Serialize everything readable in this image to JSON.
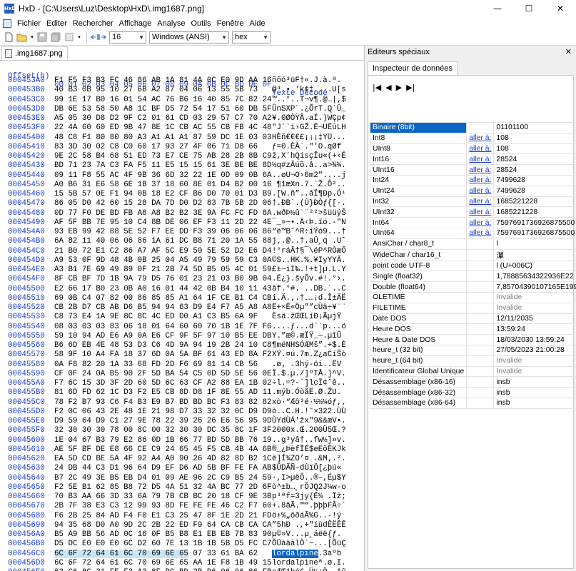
{
  "window": {
    "title": "HxD - [C:\\Users\\Luz\\Desktop\\HxD\\.img1687.png]",
    "minimize": "—",
    "maximize": "☐",
    "close": "✕"
  },
  "menu": [
    "Fichier",
    "Editer",
    "Rechercher",
    "Affichage",
    "Analyse",
    "Outils",
    "Fenêtre",
    "Aide"
  ],
  "toolbar": {
    "bytes_per_row": "16",
    "charset": "Windows (ANSI)",
    "display_mode": "hex"
  },
  "file_tab": ".img1687.png",
  "hex_view": {
    "offset_header": "Offset(h)",
    "column_header": "00 01 02 03 04 05 06 07 08 09 0A 0B 0C 0D 0E 0F",
    "text_header": "Texte Décodé",
    "rows": [
      {
        "off": "000453A0",
        "bytes": "F1 F5 F3 B3 FC 46 86 AB 1A 81 4A 0C E0 9D AA 16",
        "text": "ñõó³üF†«.J.à.ª."
      },
      {
        "off": "000453B0",
        "bytes": "40 B3 0B 95 10 27 6B A2 87 04 06 13 55 5B 73 ",
        "text": "@³.•.'k¢‡....U[s"
      },
      {
        "off": "000453C0",
        "bytes": "99 1E 17 B0 16 01 54 AC 76 B6 16 40 85 7C 82 24",
        "text": "™..°..T¬v¶.@…|‚$"
      },
      {
        "off": "000453D0",
        "bytes": "DB 6E 53 58 50 A8 1C BF D5 72 54 17 51 60 DB 5F",
        "text": "ÛnSXP¨.¿ÕrT.Q`Û_"
      },
      {
        "off": "000453E0",
        "bytes": "A5 05 30 D8 D2 9F C2 01 61 CD 03 29 57 C7 70 A2",
        "text": "¥.0ØÒŸÂ.aÍ.)WÇp¢"
      },
      {
        "off": "000453F0",
        "bytes": "22 4A 60 60 ED 9B 47 8E 1C CB AC 55 CB FB 4C 48",
        "text": "\"J``í›GŽ.Ë¬UËûLH"
      },
      {
        "off": "00045400",
        "bytes": "48 C8 F1 80 80 80 A3 A1 A1 A1 87 59 DC 1E 03 03",
        "text": "HÈñ€€€£¡¡¡‡YÜ..."
      },
      {
        "off": "00045410",
        "bytes": "83 3D 30 02 C8 C0 60 17 93 27 4F 06 71 D8 66 ",
        "text": "ƒ=0.ÈÀ`.\"'O.qØf"
      },
      {
        "off": "00045420",
        "bytes": "9E 2C 58 B4 68 51 ED 73 E7 CE 75 AB 28 2B 8B C9",
        "text": "ž,X´hQísçÎu«(+‹É"
      },
      {
        "off": "00045430",
        "bytes": "BD 71 23 7A C3 FA F5 11 E5 15 15 61 3E BE BE 8D",
        "text": "½q#zÃúõ.å..a>¾¾."
      },
      {
        "off": "00045440",
        "bytes": "09 11 F8 55 AC 4F 9B 36 6D 32 22 1E 0D 09 0B 6A",
        "text": "..øU¬O›6m2\"....j"
      },
      {
        "off": "00045450",
        "bytes": "A0 B6 31 E6 58 6E 1B 37 18 60 8E 01 D4 B2 00 16",
        "text": " ¶1æXn.7.`Ž.Ô².."
      },
      {
        "off": "00045460",
        "bytes": "15 5B 57 0E F1 94 0B 18 E2 CF B6 D0 70 01 D3 B9",
        "text": ".[W.ñ”..âÏ¶Ðp.Ó¹"
      },
      {
        "off": "00045470",
        "bytes": "86 05 D0 42 60 15 28 DA 7D D0 D2 83 7B 5B 2D 06",
        "text": "†.ÐB`.(Ú}ÐÒƒ{[-."
      },
      {
        "off": "00045480",
        "bytes": "0D 77 F0 DE BD FB A8 A8 B2 B2 3E 9A FC FC FD 8A",
        "text": ".wðÞ½û¨¨²²>šüüýŠ"
      },
      {
        "off": "00045490",
        "bytes": "AF 5F BB 7E 95 10 C4 8B DE 06 EF F3 11 2D 22 4E",
        "text": "¯_»~•.Ä‹Þ.ïó.-\"N"
      },
      {
        "off": "000454A0",
        "bytes": "93 EB 99 42 88 5E 52 F7 EE DD F3 39 06 06 06 86",
        "text": "“ë™Bˆ^R÷îÝó9...†"
      },
      {
        "off": "000454B0",
        "bytes": "6A 82 11 40 06 06 86 1A 61 DC B8 71 20 1A 55 88",
        "text": "j‚.@..†.aÜ¸q .Uˆ"
      },
      {
        "off": "000454C0",
        "bytes": "21 B0 72 E1 C2 86 A7 AF 5C E9 50 5E 52 D2 E6 D4",
        "text": "!°ráÂ†§¯\\éP^RÒæÔ"
      },
      {
        "off": "000454D0",
        "bytes": "A9 53 0F 9D 48 4B 0B 25 04 A5 49 79 59 59 C3 0A",
        "text": "©S..HK.%.¥IyYYÃ."
      },
      {
        "off": "000454E0",
        "bytes": "A3 B1 7E 69 49 89 0F 21 2B 74 5D B5 05 4C 01 59",
        "text": "£±~iI‰.!+t]µ.L.Y"
      },
      {
        "off": "000454F0",
        "bytes": "8F CB BF 7D 1B 9A 79 D5 76 01 23 21 03 B0 9B 04",
        "text": ".Ë¿}.šyÕv.#!.°›."
      },
      {
        "off": "00045500",
        "bytes": "E2 66 17 B0 23 0B A0 16 01 44 42 0B B4 10 11 43",
        "text": "âf.°#. ..DB.´..C"
      },
      {
        "off": "00045510",
        "bytes": "69 0B C4 07 82 00 86 85 85 A1 64 1F CE B1 C4 CB",
        "text": "i.Ä.‚.†……¡d.Î±ÄË"
      },
      {
        "off": "00045520",
        "bytes": "CB 2B D7 CB AB D6 B5 94 94 63 D9 E4 F7 A5 A8 A8",
        "text": "Ë+×Ë«Öµ””cÙä÷¥¨¨"
      },
      {
        "off": "00045530",
        "bytes": "C8 73 E4 1A 9E 8C 8C 4C ED D0 A1 C3 B5 6A 9F ",
        "text": "Èsä.žŒŒLíÐ¡ÃµjŸ"
      },
      {
        "off": "00045540",
        "bytes": "08 03 03 03 83 06 18 01 64 60 60 70 1B 1E 7F F6",
        "text": "....ƒ...d``p...ö"
      },
      {
        "off": "00045550",
        "bytes": "59 10 94 AD E6 A9 0A E6 CF 9F 5F 97 10 B5 EE DB",
        "text": "Y.”­æ©.æÏŸ_—.µîÛ"
      },
      {
        "off": "00045560",
        "bytes": "B6 6D EB 4E 48 53 D3 C6 4D 9A 94 19 2B 24 10 C8",
        "text": "¶mëNHSÓÆMš”.+$.È"
      },
      {
        "off": "00045570",
        "bytes": "58 9F 10 A4 FA 18 37 6D 0A 5A BF 61 43 ED 8A F2",
        "text": "XŸ.¤ú.7m.Z¿aCíŠò"
      },
      {
        "off": "00045580",
        "bytes": "0A F8 82 20 1A 33 68 FD 2D F6 69 81 14 CB 56 ",
        "text": ".ø‚ .3hý-öi..ËV"
      },
      {
        "off": "00045590",
        "bytes": "CF 0F 24 0A B5 90 2F 5D BA 54 C5 0D 5D 5E 56 0E",
        "text": "Ï.$.µ./]ºTÅ.]^V."
      },
      {
        "off": "000455A0",
        "bytes": "F7 6C 15 3D 3F 2D 60 5D 6C 63 CF A2 88 EA 1B 02",
        "text": "÷l.=?-`]lcÏ¢ˆê.."
      },
      {
        "off": "000455B0",
        "bytes": "81 6D FD 62 1C D3 F2 E5 CB 8D D8 1F 8E 55 AD 11",
        "text": ".mýb.ÓòåË.Ø.ŽU­."
      },
      {
        "off": "000455C0",
        "bytes": "78 F2 B7 93 C6 F4 B3 E9 B7 BD BD BC F3 83 82 82",
        "text": "xò·“Æô³é·½½¼óƒ‚‚"
      },
      {
        "off": "000455D0",
        "bytes": "F2 0C 06 43 2E 48 1E 21 98 D7 33 32 32 0C D9 D9",
        "text": "ò..C.H.!˜×322.ÙÙ"
      },
      {
        "off": "000455E0",
        "bytes": "D9 59 64 D9 C1 27 9E 78 22 39 26 26 E6 56 95 9D",
        "text": "ÙYdÙÁ'žx\"9&&æV•."
      },
      {
        "off": "000455F0",
        "bytes": "32 30 30 30 78 00 8C 00 32 30 30 DC 35 8C 1F 3F",
        "text": "2000x.Œ.200Ü5Œ.?"
      },
      {
        "off": "00045600",
        "bytes": "1E 04 67 B3 79 E2 86 0D 1B 66 77 BD 5D BB 76 19",
        "text": "..g³yâ†..fw½]»v."
      },
      {
        "off": "00045610",
        "bytes": "AE 5F BF DE E8 66 CE C9 24 65 45 F5 CB 4B 4A 6B",
        "text": "®_¿ÞèfÎÉ$eEõËKJk"
      },
      {
        "off": "00045620",
        "bytes": "EA 5D CD BE 5A 4F 92 A4 A0 90 26 4D 82 8D B2 1C",
        "text": "ê]Í¾ZO’¤ .&M‚.²."
      },
      {
        "off": "00045630",
        "bytes": "24 DB 44 C3 D1 96 64 D9 EF D6 AD 5B BF FE FA AB",
        "text": "$ÛDÃÑ–dÙïÖ­[¿þú«"
      },
      {
        "off": "00045640",
        "bytes": "B7 2C 49 3E B5 EB D4 01 09 AE 96 2C C9 B5 24 59",
        "text": "·,I>µëÔ..®–,Éµ$Y"
      },
      {
        "off": "00045650",
        "bytes": "F2 5E B1 62 85 B8 72 D5 4A 51 32 4A BC 77 2D 6F",
        "text": "ò^±b…¸rÕJQ2J¼w-o"
      },
      {
        "off": "00045660",
        "bytes": "70 B3 AA 66 3D 33 6A 79 7B CB BC 20 18 CF 9E 3B",
        "text": "p³ªf=3jy{Ë¼ .Ïž;"
      },
      {
        "off": "00045670",
        "bytes": "2B 7F 38 E3 C3 12 99 93 8D FE FE FE 46 C2 F7 60",
        "text": "+.8ãÃ.™“.þþþFÂ÷`"
      },
      {
        "off": "00045680",
        "bytes": "F6 2B 25 84 AD F4 F0 E1 C3 25 47 8F 1E 2D 21 FD",
        "text": "ö+%„­ôðáÃ%G..-!ý"
      },
      {
        "off": "00045690",
        "bytes": "94 35 68 D0 A0 9D 2C 2B 22 ED F9 64 CA CB CA CA",
        "text": "”5hÐ .,+\"íùdÊËÊÊ"
      },
      {
        "off": "000456A0",
        "bytes": "B5 A9 BB 56 AD 0C 16 0F B5 B8 E1 EB EB 7B 83 90",
        "text": "µ©»V­...µ¸áëë{ƒ."
      },
      {
        "off": "000456B0",
        "bytes": "D5 DC E0 E0 E0 6C D2 60 7E 13 1B 1B 5B D5 FC C7",
        "text": "ÕÜàààlÒ`~...[ÕüÇ"
      },
      {
        "off": "000456C0",
        "bytes": "C0 C0 70 0F C1 28 02 03 C3 7D 07 33 61 BA 62 ",
        "text": "ÀÀp.Á(..Ã}.3aºb"
      },
      {
        "off": "000456D0",
        "bytes": "6C 6F 72 64 61 6C 70 69 6E 65 AA 1E F8 1B 49 15",
        "text": "lordalpineª.ø.I."
      },
      {
        "off": "000456E0",
        "bytes": "63 C6 8C 31 FE F3 A3 8F DC BD 2B D6 06 06 86 FB",
        "text": "cÆŒ1þó£.Ü½+Ö..†û"
      },
      {
        "off": "000456F0",
        "bytes": "16 FF 1F BD 9D C2 CF 58 FF 04 A4 00 00 00 00 49",
        "text": ".ÿ.½.ÂÏXÿ.¤....I"
      },
      {
        "off": "00045700",
        "bytes": "45 4E 44 AE 42 60 82",
        "text": "END®B`‚"
      }
    ],
    "selected_row_index": 50,
    "selected_bytes": "6C 6F 72 64 61 6C 70 69 6E 65",
    "selected_text": "lordalpine"
  },
  "right_panel": {
    "title": "Editeurs spéciaux",
    "close": "✕",
    "tab": "Inspecteur de données",
    "nav": [
      "|◀",
      "◀",
      "▶",
      "▶|"
    ],
    "link_label": "aller à:",
    "rows": [
      {
        "name": "Binaire (8bit)",
        "link": "",
        "value": "01101100",
        "selected": true
      },
      {
        "name": "Int8",
        "link": "aller à:",
        "value": "108"
      },
      {
        "name": "UInt8",
        "link": "aller à:",
        "value": "108"
      },
      {
        "name": "Int16",
        "link": "aller à:",
        "value": "28524"
      },
      {
        "name": "UInt16",
        "link": "aller à:",
        "value": "28524"
      },
      {
        "name": "Int24",
        "link": "aller à:",
        "value": "7499628"
      },
      {
        "name": "UInt24",
        "link": "aller à:",
        "value": "7499628"
      },
      {
        "name": "Int32",
        "link": "aller à:",
        "value": "1685221228"
      },
      {
        "name": "UInt32",
        "link": "aller à:",
        "value": "1685221228"
      },
      {
        "name": "Int64",
        "link": "aller à:",
        "value": "7597691736926875500"
      },
      {
        "name": "UInt64",
        "link": "aller à:",
        "value": "7597691736926875500"
      },
      {
        "name": "AnsiChar / char8_t",
        "link": "",
        "value": "l"
      },
      {
        "name": "WideChar / char16_t",
        "link": "",
        "value": "潬"
      },
      {
        "name": "point code UTF-8",
        "link": "",
        "value": "l (U+006C)"
      },
      {
        "name": "Single (float32)",
        "link": "",
        "value": "1,78885634322936E22"
      },
      {
        "name": "Double (float64)",
        "link": "",
        "value": "7,85704390107165E199"
      },
      {
        "name": "OLETIME",
        "link": "",
        "value": "Invalide",
        "invalid": true
      },
      {
        "name": "FILETIME",
        "link": "",
        "value": "Invalide",
        "invalid": true
      },
      {
        "name": "Date DOS",
        "link": "",
        "value": "12/11/2035"
      },
      {
        "name": "Heure DOS",
        "link": "",
        "value": "13:59:24"
      },
      {
        "name": "Heure & Date DOS",
        "link": "",
        "value": "18/03/2030 13:59:24"
      },
      {
        "name": "heure_t (32 bit)",
        "link": "",
        "value": "27/05/2023 21:00:28"
      },
      {
        "name": "heure_t (64 bit)",
        "link": "",
        "value": "Invalide",
        "invalid": true
      },
      {
        "name": "Identificateur Global Unique",
        "link": "",
        "value": "Invalide",
        "invalid": true
      },
      {
        "name": "Désassemblage (x86-16)",
        "link": "",
        "value": "insb"
      },
      {
        "name": "Désassemblage (x86-32)",
        "link": "",
        "value": "insb"
      },
      {
        "name": "Désassemblage (x86-64)",
        "link": "",
        "value": "insb"
      }
    ]
  },
  "colors": {
    "offset_blue": "#1a3cc8",
    "selection": "#0a67c8",
    "highlight": "#c9e6f8"
  }
}
